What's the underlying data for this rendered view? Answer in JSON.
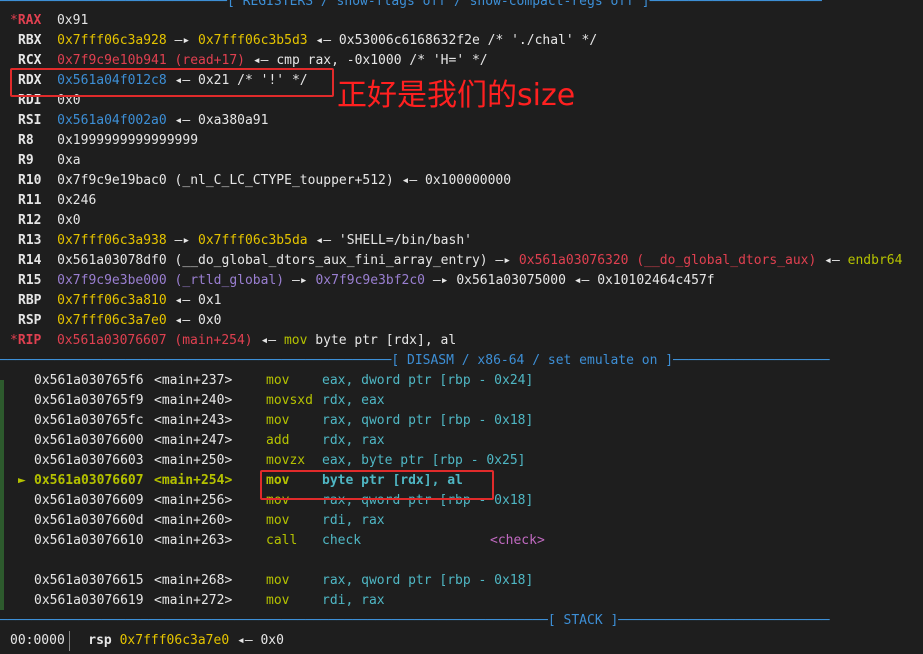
{
  "header_registers": "─────────────────────────────[ REGISTERS / show-flags off / show-compact-regs off ]──────────────────────",
  "header_disasm": "──────────────────────────────────────────────────[ DISASM / x86-64 / set emulate on ]────────────────────",
  "header_stack": "──────────────────────────────────────────────────────────────────────[ STACK ]───────────────────────────",
  "annotation": "正好是我们的size",
  "registers": {
    "rax_star": "*",
    "rax_name": "RAX",
    "rax_val": "0x91",
    "rbx_name": "RBX",
    "rbx_a": "0x7fff06c3a928",
    "rbx_arrow1": " —▸ ",
    "rbx_b": "0x7fff06c3b5d3",
    "rbx_rest": " ◂— 0x53006c6168632f2e /* './chal' */",
    "rcx_name": "RCX",
    "rcx_a": "0x7f9c9e10b941",
    "rcx_b": " (read+17)",
    "rcx_c": " ◂— ",
    "rcx_d": "cmp rax, -0x1000 /* 'H=' */",
    "rdx_name": "RDX",
    "rdx_a": "0x561a04f012c8",
    "rdx_rest": " ◂— 0x21 /* '!' */",
    "rdi_name": "RDI",
    "rdi_val": "0x0",
    "rsi_name": "RSI",
    "rsi_a": "0x561a04f002a0",
    "rsi_rest": " ◂— 0xa380a91",
    "r8_name": "R8",
    "r8_val": "0x1999999999999999",
    "r9_name": "R9",
    "r9_val": "0xa",
    "r10_name": "R10",
    "r10_val": "0x7f9c9e19bac0 (_nl_C_LC_CTYPE_toupper+512) ◂— 0x100000000",
    "r11_name": "R11",
    "r11_val": "0x246",
    "r12_name": "R12",
    "r12_val": "0x0",
    "r13_name": "R13",
    "r13_a": "0x7fff06c3a938",
    "r13_arrow": " —▸ ",
    "r13_b": "0x7fff06c3b5da",
    "r13_rest": " ◂— 'SHELL=/bin/bash'",
    "r14_name": "R14",
    "r14_a": "0x561a03078df0 (__do_global_dtors_aux_fini_array_entry) —▸ ",
    "r14_b": "0x561a03076320 (__do_global_dtors_aux)",
    "r14_c": " ◂— ",
    "r14_d": "endbr64",
    "r15_name": "R15",
    "r15_a": "0x7f9c9e3be000 (_rtld_global)",
    "r15_arrow": " —▸ ",
    "r15_b": "0x7f9c9e3bf2c0",
    "r15_rest": " —▸ 0x561a03075000 ◂— 0x10102464c457f",
    "rbp_name": "RBP",
    "rbp_a": "0x7fff06c3a810",
    "rbp_rest": " ◂— 0x1",
    "rsp_name": "RSP",
    "rsp_a": "0x7fff06c3a7e0",
    "rsp_rest": " ◂— 0x0",
    "rip_star": "*",
    "rip_name": "RIP",
    "rip_a": "0x561a03076607 (main+254)",
    "rip_arrow": " ◂— ",
    "rip_mn": "mov",
    "rip_ops": " byte ptr [rdx], al"
  },
  "disasm": [
    {
      "addr": "0x561a030765f6",
      "sym": "<main+237>",
      "mn": "mov",
      "ops": "eax, dword ptr [rbp - 0x24]"
    },
    {
      "addr": "0x561a030765f9",
      "sym": "<main+240>",
      "mn": "movsxd",
      "ops": "rdx, eax"
    },
    {
      "addr": "0x561a030765fc",
      "sym": "<main+243>",
      "mn": "mov",
      "ops": "rax, qword ptr [rbp - 0x18]"
    },
    {
      "addr": "0x561a03076600",
      "sym": "<main+247>",
      "mn": "add",
      "ops": "rdx, rax"
    },
    {
      "addr": "0x561a03076603",
      "sym": "<main+250>",
      "mn": "movzx",
      "ops": "eax, byte ptr [rbp - 0x25]"
    },
    {
      "marker": "►",
      "addr": "0x561a03076607",
      "sym": "<main+254>",
      "mn": "mov",
      "ops": "byte ptr [rdx], al"
    },
    {
      "addr": "0x561a03076609",
      "sym": "<main+256>",
      "mn": "mov",
      "ops": "rax, qword ptr [rbp - 0x18]"
    },
    {
      "addr": "0x561a0307660d",
      "sym": "<main+260>",
      "mn": "mov",
      "ops": "rdi, rax"
    },
    {
      "addr": "0x561a03076610",
      "sym": "<main+263>",
      "mn": "call",
      "ops": "check",
      "target": "<check>"
    },
    {
      "addr": "0x561a03076615",
      "sym": "<main+268>",
      "mn": "mov",
      "ops": "rax, qword ptr [rbp - 0x18]"
    },
    {
      "addr": "0x561a03076619",
      "sym": "<main+272>",
      "mn": "mov",
      "ops": "rdi, rax"
    }
  ],
  "stack": {
    "idx": "00:0000",
    "reg": "rsp",
    "addr": "0x7fff06c3a7e0",
    "rest": " ◂— 0x0"
  },
  "colors": {
    "red": "#e04050",
    "yellow": "#e5c400",
    "blue": "#3d8fd6",
    "purple": "#9a7fd1",
    "magenta": "#c16ac1",
    "green": "#b5c200",
    "cyan": "#4fb7c4",
    "highlight_box": "#e02b2b"
  }
}
